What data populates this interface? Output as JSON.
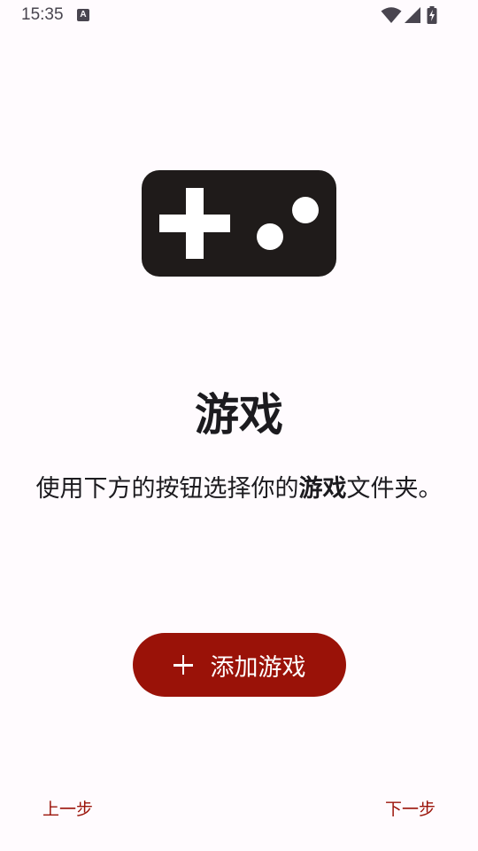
{
  "status_bar": {
    "time": "15:35",
    "notification_icon": "text-a-icon",
    "icons": [
      "wifi-icon",
      "cell-signal-icon",
      "battery-charging-icon"
    ]
  },
  "hero_icon": "gamepad-icon",
  "title": "游戏",
  "description": {
    "before": "使用下方的按钮选择你的",
    "highlight": "游戏",
    "after": "文件夹。"
  },
  "add_button": {
    "icon": "plus-icon",
    "label": "添加游戏"
  },
  "nav": {
    "prev_label": "上一步",
    "next_label": "下一步"
  },
  "colors": {
    "background": "#fffbfe",
    "accent": "#9a1208",
    "icon_dark": "#1f1b1a",
    "text": "#1c1b1f"
  }
}
